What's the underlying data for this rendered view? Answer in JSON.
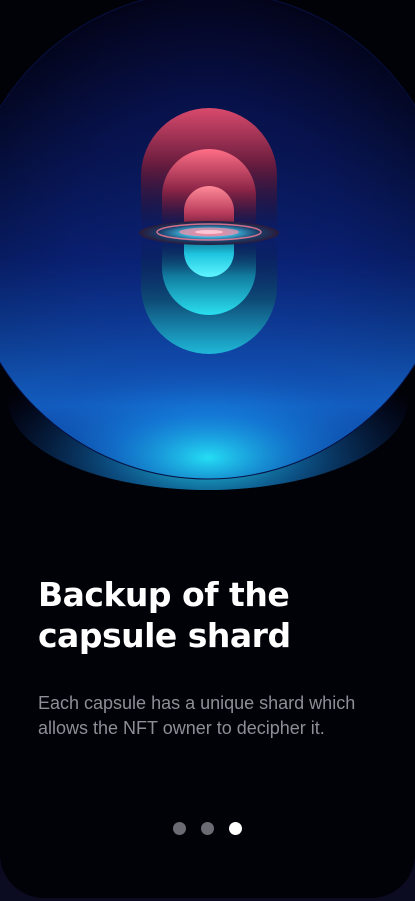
{
  "onboarding": {
    "title": "Backup of the capsule shard",
    "description": "Each capsule has a unique shard which allows the NFT owner to decipher it.",
    "pagination": {
      "pages": 3,
      "active_page": 3
    }
  },
  "colors": {
    "background": "#010108",
    "glow_top": "#e0506f",
    "glow_bottom": "#25e6f2",
    "title_text": "#ffffff",
    "body_text": "#8e8e97",
    "dot_inactive": "#6b6b73",
    "dot_active": "#ffffff"
  },
  "illustration": {
    "name": "capsule-shard-illustration",
    "icon": "nested-capsules-with-disc"
  }
}
